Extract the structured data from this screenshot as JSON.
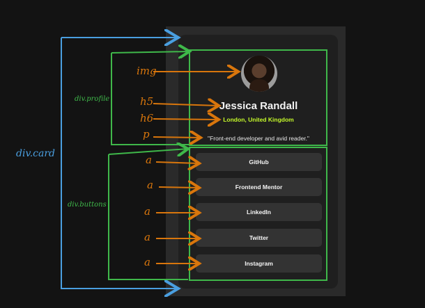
{
  "annotations": {
    "card_label": "div.card",
    "profile_label": "div.profile",
    "buttons_label": "div.buttons",
    "img_label": "img",
    "h5_label": "h5",
    "h6_label": "h6",
    "p_label": "p",
    "a_label": "a"
  },
  "profile": {
    "name": "Jessica Randall",
    "location": "London, United Kingdom",
    "bio": "\"Front-end developer and avid reader.\""
  },
  "buttons": [
    "GitHub",
    "Frontend Mentor",
    "LinkedIn",
    "Twitter",
    "Instagram"
  ],
  "colors": {
    "annotation_orange": "#d9760c",
    "annotation_green": "#3fb84a",
    "annotation_blue": "#4a9fe0",
    "location_accent": "#c4f82a"
  },
  "icons": {
    "avatar": "profile-photo"
  }
}
